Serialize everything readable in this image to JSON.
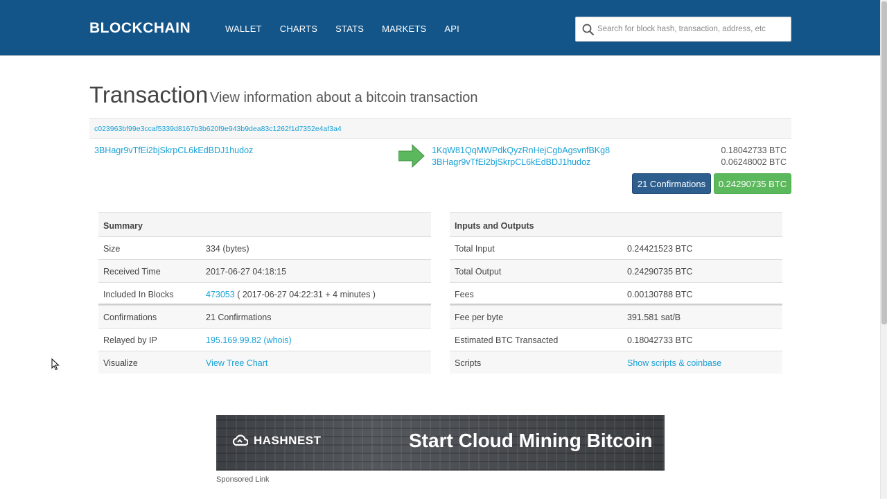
{
  "header": {
    "logo": "BLOCKCHAIN",
    "nav": [
      "WALLET",
      "CHARTS",
      "STATS",
      "MARKETS",
      "API"
    ],
    "search_placeholder": "Search for block hash, transaction, address, etc",
    "bg_color": "#145589"
  },
  "page": {
    "title": "Transaction",
    "subtitle": "View information about a bitcoin transaction"
  },
  "transaction": {
    "hash": "c023963bf99e3ccaf5339d8167b3b620f9e943b9dea83c1262f1d7352e4af3a4",
    "inputs": [
      "3BHagr9vTfEi2bjSkrpCL6kEdBDJ1hudoz"
    ],
    "outputs": [
      {
        "address": "1KqW81QqMWPdkQyzRnHejCgbAgsvnfBKg8",
        "value": "0.18042733 BTC"
      },
      {
        "address": "3BHagr9vTfEi2bjSkrpCL6kEdBDJ1hudoz",
        "value": "0.06248002 BTC"
      }
    ],
    "confirmations_button": "21 Confirmations",
    "total_button": "0.24290735 BTC"
  },
  "summary": {
    "heading": "Summary",
    "size_label": "Size",
    "size_value": "334 (bytes)",
    "received_label": "Received Time",
    "received_value": "2017-06-27 04:18:15",
    "blocks_label": "Included In Blocks",
    "block_link": "473053",
    "block_extra": " ( 2017-06-27 04:22:31 + 4 minutes )",
    "confirmations_label": "Confirmations",
    "confirmations_value": "21 Confirmations",
    "relayed_label": "Relayed by IP",
    "relayed_value": "195.169.99.82 (whois)",
    "visualize_label": "Visualize",
    "visualize_link": "View Tree Chart"
  },
  "io": {
    "heading": "Inputs and Outputs",
    "total_input_label": "Total Input",
    "total_input_value": "0.24421523 BTC",
    "total_output_label": "Total Output",
    "total_output_value": "0.24290735 BTC",
    "fees_label": "Fees",
    "fees_value": "0.00130788 BTC",
    "fee_per_byte_label": "Fee per byte",
    "fee_per_byte_value": "391.581 sat/B",
    "estimated_label": "Estimated BTC Transacted",
    "estimated_value": "0.18042733 BTC",
    "scripts_label": "Scripts",
    "scripts_link": "Show scripts & coinbase"
  },
  "ad": {
    "brand": "HASHNEST",
    "tagline": "Start Cloud Mining Bitcoin",
    "sponsored": "Sponsored Link"
  }
}
